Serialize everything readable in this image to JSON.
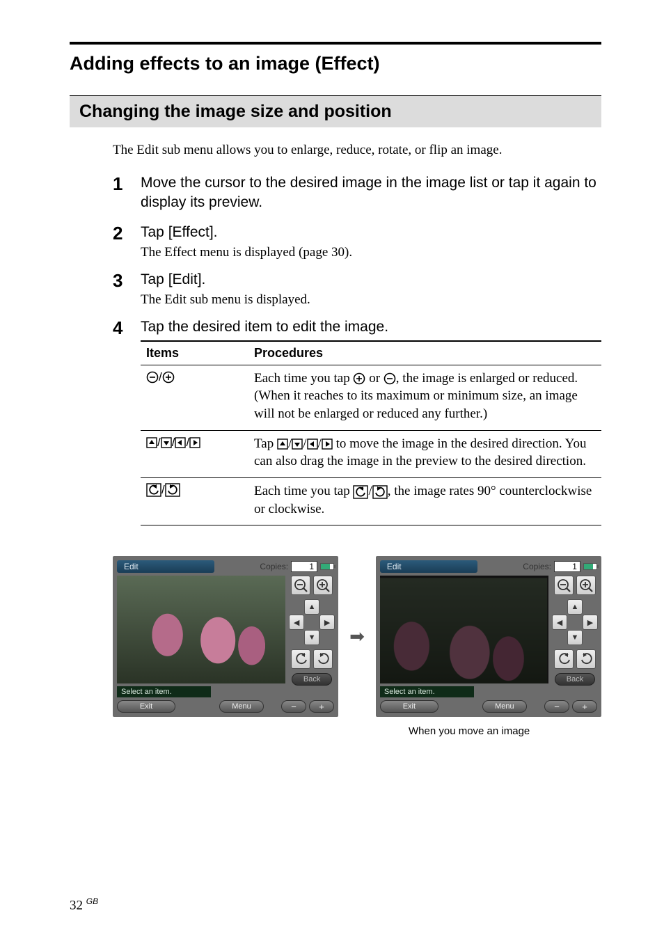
{
  "section_title": "Adding effects to an image (Effect)",
  "sub_section": "Changing the image size and position",
  "intro": "The Edit sub menu allows you to enlarge, reduce, rotate, or flip an image.",
  "steps": [
    {
      "num": "1",
      "main": "Move the cursor to the desired image in the image list or tap it again to display its preview.",
      "desc": ""
    },
    {
      "num": "2",
      "main": "Tap [Effect].",
      "desc": "The Effect menu is displayed (page 30)."
    },
    {
      "num": "3",
      "main": "Tap [Edit].",
      "desc": "The Edit sub menu is displayed."
    },
    {
      "num": "4",
      "main": "Tap the desired item to edit the image.",
      "desc": ""
    }
  ],
  "table": {
    "headers": [
      "Items",
      "Procedures"
    ],
    "rows": [
      {
        "items": "⊖/⊕",
        "proc_before": "Each time you tap ",
        "proc_mid": " or ",
        "proc_after": ", the image is enlarged or reduced. (When it reaches to its maximum or minimum size, an image will not be enlarged or reduced any further.)"
      },
      {
        "proc_before": "Tap ",
        "proc_after": " to move the image in the desired direction.  You can also drag the image in the preview to the desired direction."
      },
      {
        "proc_before": "Each time you tap ",
        "proc_after": ", the image rates 90° counterclockwise or clockwise."
      }
    ]
  },
  "shot": {
    "tab": "Edit",
    "copies_label": "Copies:",
    "copies_value": "1",
    "back": "Back",
    "status": "Select an item.",
    "exit": "Exit",
    "menu": "Menu"
  },
  "caption": "When you move an image",
  "page": "32",
  "gb": "GB"
}
